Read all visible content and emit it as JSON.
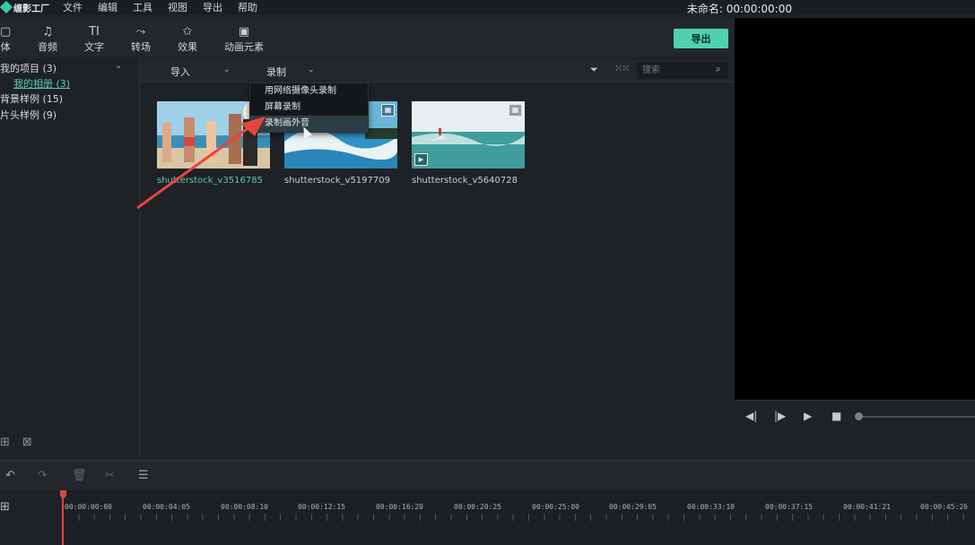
{
  "app": {
    "logo_text": "缠影工厂",
    "menus": [
      "文件",
      "编辑",
      "工具",
      "视图",
      "导出",
      "帮助"
    ],
    "project_title": "未命名: 00:00:00:00"
  },
  "toolbar": {
    "tabs": [
      {
        "label": "体",
        "icon": "media-icon"
      },
      {
        "label": "音频",
        "icon": "music-note-icon"
      },
      {
        "label": "文字",
        "icon": "text-icon"
      },
      {
        "label": "转场",
        "icon": "transition-icon"
      },
      {
        "label": "效果",
        "icon": "effects-icon"
      },
      {
        "label": "动画元素",
        "icon": "image-icon"
      }
    ],
    "export_label": "导出",
    "accent_color": "#4fd1b0"
  },
  "library": {
    "items": [
      {
        "label": "我的项目 (3)"
      },
      {
        "label": "我的相册 (3)"
      },
      {
        "label": "背景样例 (15)"
      },
      {
        "label": "片头样例 (9)"
      }
    ]
  },
  "media_bar": {
    "import_label": "导入",
    "record_label": "录制",
    "search_placeholder": "搜索"
  },
  "record_menu": {
    "items": [
      "用网络摄像头录制",
      "屏幕录制",
      "录制画外音"
    ],
    "hovered_index": 2
  },
  "clips": [
    {
      "name": "shutterstock_v3516785",
      "selected": true
    },
    {
      "name": "shutterstock_v5197709",
      "selected": false
    },
    {
      "name": "shutterstock_v5640728",
      "selected": false
    }
  ],
  "timeline": {
    "timecodes": [
      "00:00:00:00",
      "00:00:04:05",
      "00:00:08:10",
      "00:00:12:15",
      "00:00:16:20",
      "00:00:20:25",
      "00:00:25:00",
      "00:00:29:05",
      "00:00:33:10",
      "00:00:37:15",
      "00:00:41:21",
      "00:00:45:26"
    ]
  }
}
